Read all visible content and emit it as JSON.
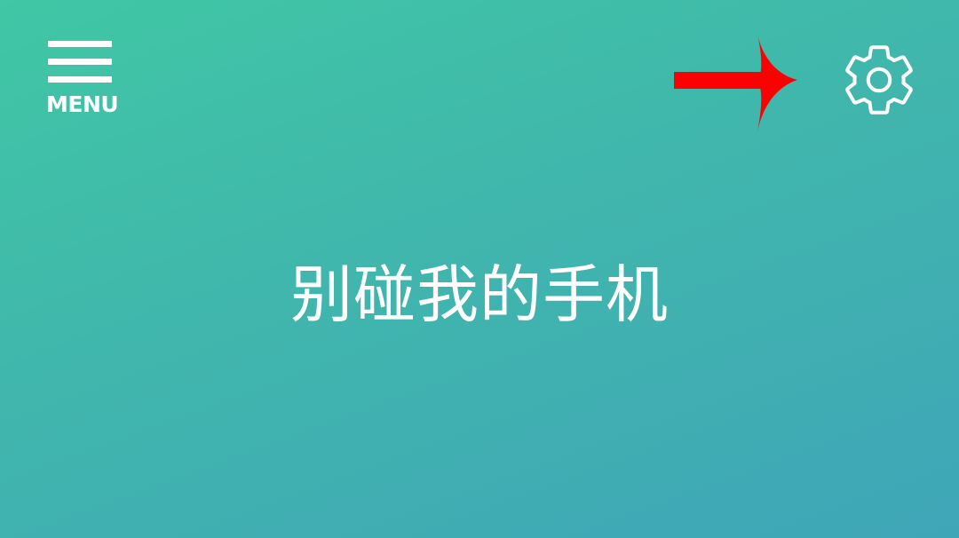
{
  "header": {
    "menu_label": "MENU",
    "menu_icon": "hamburger-icon",
    "settings_icon": "gear-icon",
    "annotation_arrow_icon": "arrow-right-icon",
    "annotation_arrow_color": "#ff0000"
  },
  "main": {
    "title": "别碰我的手机"
  },
  "colors": {
    "background_start": "#40c7a5",
    "background_end": "#3fa6b8",
    "foreground": "#ffffff"
  }
}
